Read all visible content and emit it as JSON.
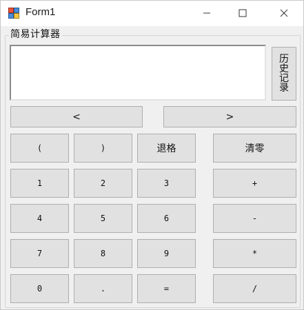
{
  "window": {
    "title": "Form1",
    "minimize_icon": "minimize-icon",
    "maximize_icon": "maximize-icon",
    "close_icon": "close-icon",
    "app_icon": "winforms-app-icon"
  },
  "group": {
    "title": "简易计算器"
  },
  "display": {
    "value": ""
  },
  "history_button": {
    "label": "历史记录"
  },
  "nav": {
    "prev_label": "<",
    "next_label": ">"
  },
  "keys": {
    "open_paren": "(",
    "close_paren": ")",
    "backspace": "退格",
    "clear": "清零",
    "one": "1",
    "two": "2",
    "three": "3",
    "plus": "+",
    "four": "4",
    "five": "5",
    "six": "6",
    "minus": "-",
    "seven": "7",
    "eight": "8",
    "nine": "9",
    "multiply": "*",
    "zero": "0",
    "dot": ".",
    "equals": "=",
    "divide": "/"
  }
}
